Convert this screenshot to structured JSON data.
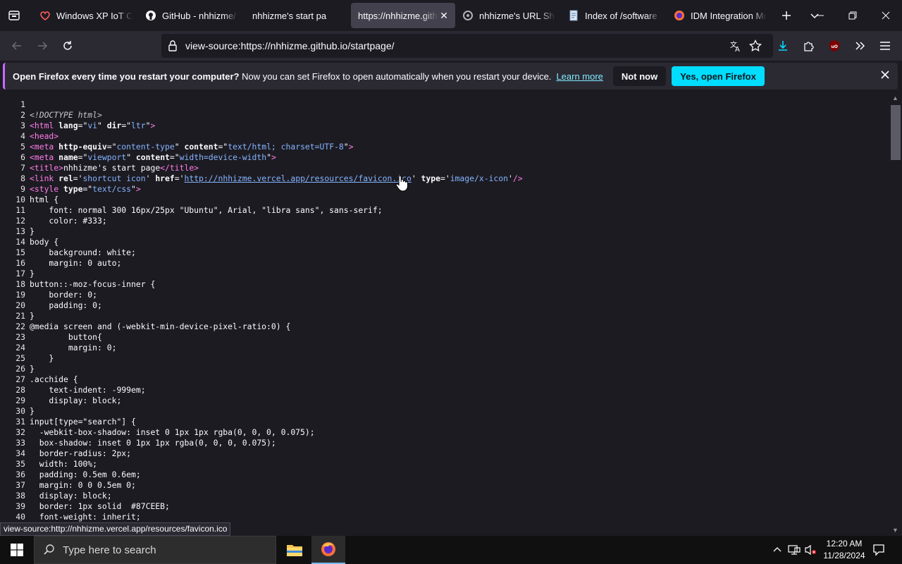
{
  "tabs": [
    {
      "title": "Windows XP IoT Op",
      "icon": "ms-store-icon"
    },
    {
      "title": "GitHub - nhhizme/",
      "icon": "github-icon"
    },
    {
      "title": "nhhizme's start pa",
      "icon": "none"
    },
    {
      "title": "https://nhhizme.gith",
      "icon": "none",
      "active": true
    },
    {
      "title": "nhhizme's URL Sho",
      "icon": "link-icon"
    },
    {
      "title": "Index of /software",
      "icon": "page-icon"
    },
    {
      "title": "IDM Integration Mo",
      "icon": "firefox-icon"
    }
  ],
  "urlbar": {
    "url": "view-source:https://nhhizme.github.io/startpage/"
  },
  "notification": {
    "bold": "Open Firefox every time you restart your computer?",
    "text": " Now you can set Firefox to open automatically when you restart your device.",
    "learn_more": "Learn more",
    "not_now": "Not now",
    "yes": "Yes, open Firefox"
  },
  "status_link": "view-source:http://nhhizme.vercel.app/resources/favicon.ico",
  "source_lines": [
    "",
    "<!DOCTYPE html>",
    "<html lang=\"vi\" dir=\"ltr\">",
    "<head>",
    "<meta http-equiv=\"content-type\" content=\"text/html; charset=UTF-8\">",
    "<meta name=\"viewport\" content=\"width=device-width\">",
    "<title>nhhizme's start page</title>",
    "<link rel='shortcut icon' href='http://nhhizme.vercel.app/resources/favicon.ico' type='image/x-icon'/>",
    "<style type=\"text/css\">",
    "html {",
    "    font: normal 300 16px/25px \"Ubuntu\", Arial, \"libra sans\", sans-serif;",
    "    color: #333;",
    "}",
    "body {",
    "    background: white;",
    "    margin: 0 auto;",
    "}",
    "button::-moz-focus-inner {",
    "    border: 0;",
    "    padding: 0;",
    "}",
    "@media screen and (-webkit-min-device-pixel-ratio:0) {",
    "        button{",
    "        margin: 0;",
    "    }",
    "}",
    ".acchide {",
    "    text-indent: -999em;",
    "    display: block;",
    "}",
    "input[type=\"search\"] {",
    "  -webkit-box-shadow: inset 0 1px 1px rgba(0, 0, 0, 0.075);",
    "  box-shadow: inset 0 1px 1px rgba(0, 0, 0, 0.075);",
    "  border-radius: 2px;",
    "  width: 100%;",
    "  padding: 0.5em 0.6em;",
    "  margin: 0 0 0.5em 0;",
    "  display: block;",
    "  border: 1px solid  #87CEEB;",
    "  font-weight: inherit;"
  ],
  "taskbar": {
    "search_placeholder": "Type here to search",
    "time": "12:20 AM",
    "date": "11/28/2024"
  },
  "colors": {
    "accent": "#00ddff",
    "tag": "#ff7de9",
    "attr_value": "#86b5ff",
    "notif_border": "#c56bff"
  }
}
